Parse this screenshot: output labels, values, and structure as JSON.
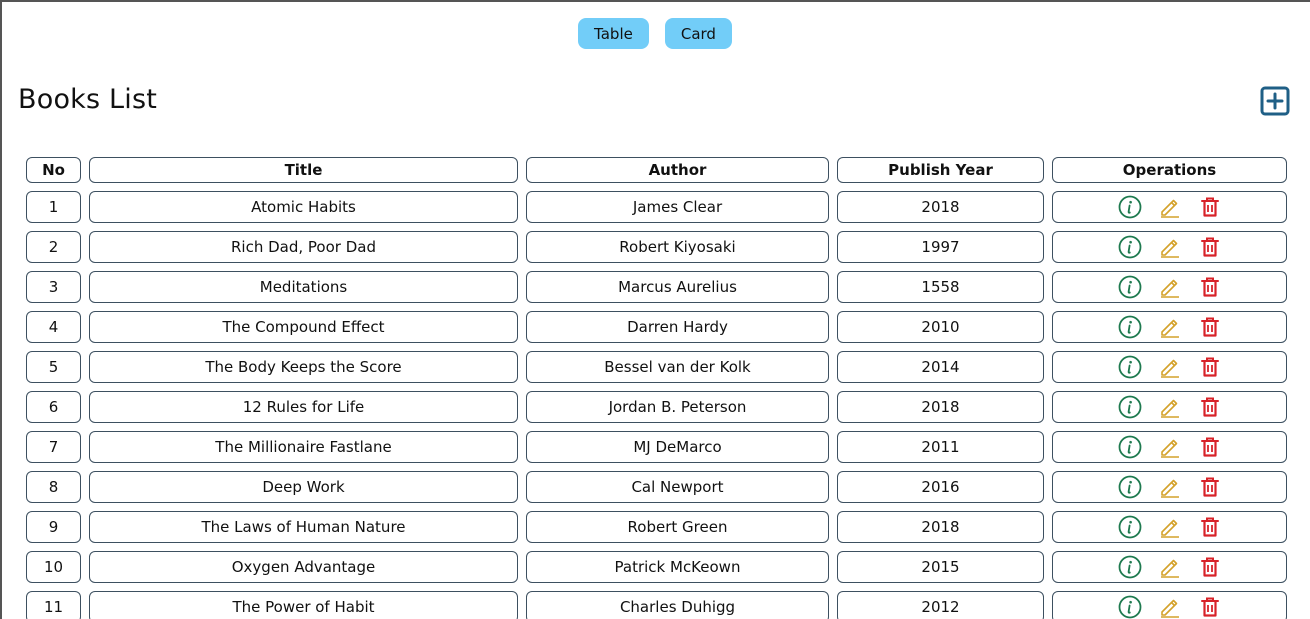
{
  "view_toggle": {
    "table_label": "Table",
    "card_label": "Card"
  },
  "page": {
    "title": "Books List",
    "add_icon": "plus-square-icon"
  },
  "table": {
    "headers": {
      "no": "No",
      "title": "Title",
      "author": "Author",
      "year": "Publish Year",
      "operations": "Operations"
    },
    "operation_icons": [
      "info-circle-icon",
      "edit-pencil-icon",
      "trash-icon"
    ],
    "rows": [
      {
        "no": "1",
        "title": "Atomic Habits",
        "author": "James Clear",
        "year": "2018"
      },
      {
        "no": "2",
        "title": "Rich Dad, Poor Dad",
        "author": "Robert Kiyosaki",
        "year": "1997"
      },
      {
        "no": "3",
        "title": "Meditations",
        "author": "Marcus Aurelius",
        "year": "1558"
      },
      {
        "no": "4",
        "title": "The Compound Effect",
        "author": "Darren Hardy",
        "year": "2010"
      },
      {
        "no": "5",
        "title": "The Body Keeps the Score",
        "author": "Bessel van der Kolk",
        "year": "2014"
      },
      {
        "no": "6",
        "title": "12 Rules for Life",
        "author": "Jordan B. Peterson",
        "year": "2018"
      },
      {
        "no": "7",
        "title": "The Millionaire Fastlane",
        "author": "MJ DeMarco",
        "year": "2011"
      },
      {
        "no": "8",
        "title": "Deep Work",
        "author": "Cal Newport",
        "year": "2016"
      },
      {
        "no": "9",
        "title": "The Laws of Human Nature",
        "author": "Robert Green",
        "year": "2018"
      },
      {
        "no": "10",
        "title": "Oxygen Advantage",
        "author": "Patrick McKeown",
        "year": "2015"
      },
      {
        "no": "11",
        "title": "The Power of Habit",
        "author": "Charles Duhigg",
        "year": "2012"
      }
    ]
  },
  "colors": {
    "toggle_button": "#72cdf8",
    "add_icon": "#1f5f86",
    "info_icon": "#1e7a4f",
    "edit_icon": "#d4a22b",
    "delete_icon": "#d8232a",
    "cell_border": "#3d5060"
  }
}
